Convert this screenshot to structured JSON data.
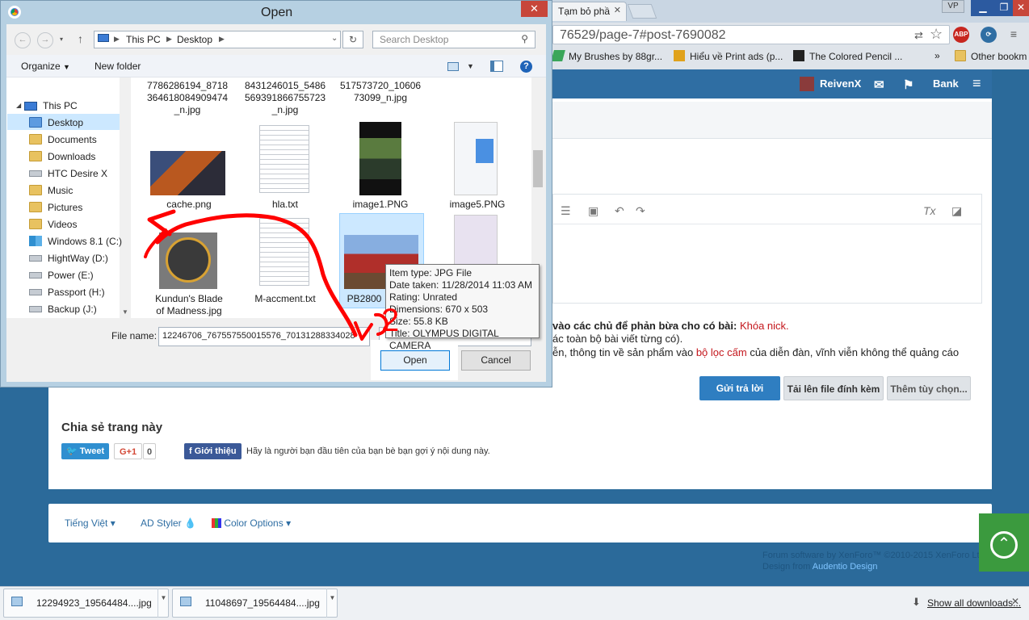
{
  "browser": {
    "tab_active": "Tạm bỏ phầ",
    "omnibox_url": "76529/page-7#post-7690082",
    "profile": "VP",
    "ext_abp": "ABP",
    "bookmarks": [
      {
        "label": "My Brushes by 88gr..."
      },
      {
        "label": "Hiểu về Print ads (p..."
      },
      {
        "label": "The Colored Pencil ..."
      }
    ],
    "bookmarks_more": "»",
    "other_bookmarks": "Other bookm"
  },
  "forum": {
    "nav": {
      "user": "ReivenX",
      "bank": "Bank"
    },
    "rules": {
      "line1_text": "vào các chủ để phản bừa cho có bài:",
      "line1_penalty": "Khóa nick.",
      "line2": "ác toàn bộ bài viết từng có).",
      "line3_pre": "ễn, thông tin về sản phẩm vào",
      "line3_link": "bộ lọc cấm",
      "line3_post": "của diễn đàn, vĩnh viễn không thể quảng cáo"
    },
    "buttons": {
      "reply": "Gửi trả lời",
      "upload": "Tải lên file đính kèm",
      "more_options": "Thêm tùy chọn..."
    },
    "share": {
      "title": "Chia sẻ trang này",
      "tweet": "Tweet",
      "gplus": "G+1",
      "gplus_count": "0",
      "fb": "Giới thiệu",
      "fb_text": "Hãy là người bạn đầu tiên của bạn bè bạn gợi ý nội dung này."
    },
    "footer": {
      "language": "Tiếng Việt",
      "styler": "AD Styler",
      "colors": "Color Options",
      "copyright1": "Forum software by XenForo™ ©2010-2015 XenForo Lt",
      "copyright2_pre": "Design from",
      "copyright2_link": "Audentio Design"
    }
  },
  "downloads": {
    "items": [
      {
        "name": "12294923_19564484....jpg"
      },
      {
        "name": "11048697_19564484....jpg"
      }
    ],
    "show_all": "Show all downloads..."
  },
  "dialog": {
    "title": "Open",
    "breadcrumb": [
      "This PC",
      "Desktop"
    ],
    "search_placeholder": "Search Desktop",
    "organize": "Organize",
    "new_folder": "New folder",
    "tree": [
      {
        "label": "This PC"
      },
      {
        "label": "Desktop"
      },
      {
        "label": "Documents"
      },
      {
        "label": "Downloads"
      },
      {
        "label": "HTC Desire X"
      },
      {
        "label": "Music"
      },
      {
        "label": "Pictures"
      },
      {
        "label": "Videos"
      },
      {
        "label": "Windows 8.1 (C:)"
      },
      {
        "label": "HightWay (D:)"
      },
      {
        "label": "Power (E:)"
      },
      {
        "label": "Passport (H:)"
      },
      {
        "label": "Backup (J:)"
      }
    ],
    "files_top": [
      {
        "l1": "7786286194_8718",
        "l2": "364618084909474",
        "l3": "_n.jpg"
      },
      {
        "l1": "8431246015_5486",
        "l2": "569391866755723",
        "l3": "_n.jpg"
      },
      {
        "l1": "517573720_10606",
        "l2": "73099_n.jpg",
        "l3": ""
      }
    ],
    "files_row2": [
      "cache.png",
      "hla.txt",
      "image1.PNG",
      "image5.PNG"
    ],
    "files_row3": [
      {
        "l1": "Kundun's Blade",
        "l2": "of Madness.jpg"
      },
      {
        "l1": "M-accment.txt",
        "l2": ""
      },
      {
        "l1": "PB2800",
        "l2": ""
      }
    ],
    "filename_label": "File name:",
    "filename_value": "12246706_767557550015576_70131288334028",
    "open": "Open",
    "cancel": "Cancel",
    "tooltip": {
      "type": "Item type: JPG File",
      "date": "Date taken: 11/28/2014 11:03 AM",
      "rating": "Rating: Unrated",
      "dims": "Dimensions: 670 x 503",
      "size": "Size: 55.8 KB",
      "title": "Title: OLYMPUS DIGITAL CAMERA"
    },
    "annotation_number": "2"
  },
  "colors": {
    "page_bg": "#2b6a9a",
    "nav_blue": "#2f6ea3",
    "primary_button": "#2f7ec1",
    "scroll_top": "#3b9a3e",
    "annotation_red": "#ff0000"
  }
}
